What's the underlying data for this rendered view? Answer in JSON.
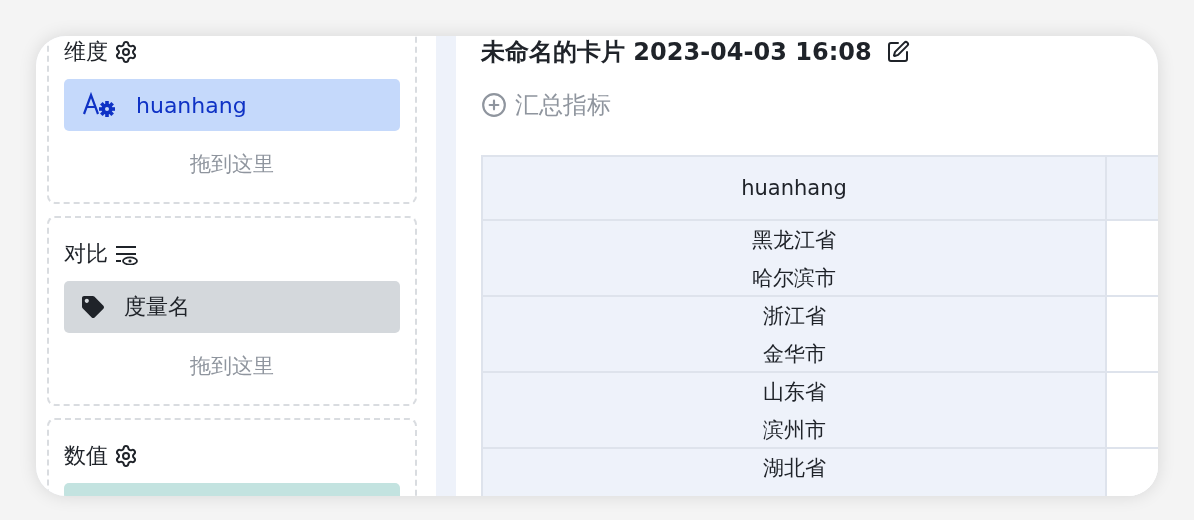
{
  "sections": [
    {
      "title": "维度",
      "kind": "dimension",
      "fields": [
        {
          "kind": "text",
          "label": "huanhang"
        }
      ],
      "drop_hint": "拖到这里"
    },
    {
      "title": "对比",
      "kind": "compare",
      "fields": [
        {
          "kind": "tag",
          "label": "度量名"
        }
      ],
      "drop_hint": "拖到这里"
    },
    {
      "title": "数值",
      "kind": "value",
      "fields": [
        {
          "kind": "measure"
        }
      ]
    }
  ],
  "card": {
    "title": "未命名的卡片 2023-04-03 16:08",
    "summary_button": "汇总指标",
    "table": {
      "columns": [
        "huanhang"
      ],
      "rows": [
        {
          "lines": [
            "黑龙江省",
            "哈尔滨市"
          ]
        },
        {
          "lines": [
            "浙江省",
            "金华市"
          ]
        },
        {
          "lines": [
            "山东省",
            "滨州市"
          ]
        },
        {
          "lines": [
            "湖北省"
          ]
        }
      ]
    }
  }
}
